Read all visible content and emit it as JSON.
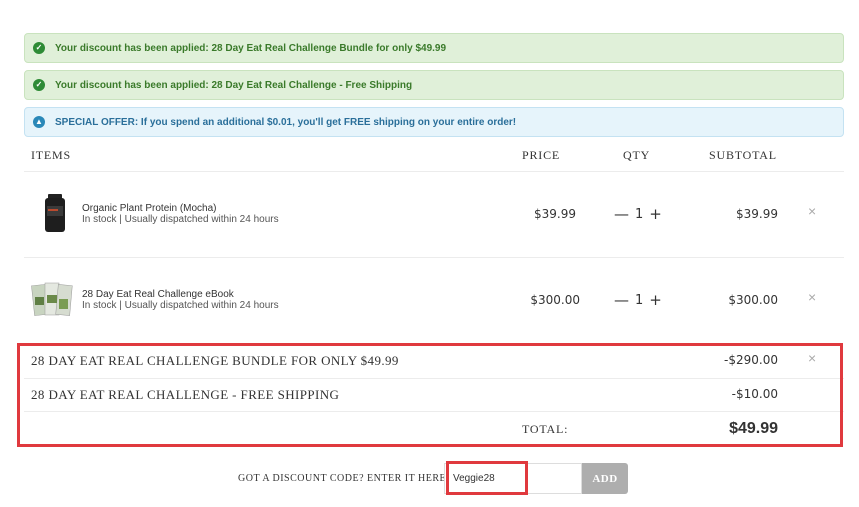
{
  "notices": [
    {
      "type": "success",
      "icon": "check-circle-icon",
      "text": "Your discount has been applied: 28 Day Eat Real Challenge Bundle for only $49.99"
    },
    {
      "type": "success",
      "icon": "check-circle-icon",
      "text": "Your discount has been applied: 28 Day Eat Real Challenge - Free Shipping"
    },
    {
      "type": "info",
      "icon": "info-drop-icon",
      "text": "SPECIAL OFFER: If you spend an additional $0.01, you'll get FREE shipping on your entire order!"
    }
  ],
  "table": {
    "headers": {
      "items": "ITEMS",
      "price": "PRICE",
      "qty": "QTY",
      "subtotal": "SUBTOTAL"
    }
  },
  "items": [
    {
      "name": "Organic Plant Protein (Mocha)",
      "stock": "In stock | Usually dispatched within 24 hours",
      "price": "$39.99",
      "qty": "1",
      "subtotal": "$39.99"
    },
    {
      "name": "28 Day Eat Real Challenge eBook",
      "stock": "In stock | Usually dispatched within 24 hours",
      "price": "$300.00",
      "qty": "1",
      "subtotal": "$300.00"
    }
  ],
  "qty_controls": {
    "minus": "—",
    "plus": "+"
  },
  "remove_glyph": "×",
  "discounts": [
    {
      "label": "28 DAY EAT REAL CHALLENGE BUNDLE FOR ONLY $49.99",
      "amount": "-$290.00"
    },
    {
      "label": "28 DAY EAT REAL CHALLENGE - FREE SHIPPING",
      "amount": "-$10.00"
    }
  ],
  "total": {
    "label": "TOTAL:",
    "value": "$49.99"
  },
  "discount_code": {
    "label": "GOT A DISCOUNT CODE? ENTER IT HERE:",
    "value": "Veggie28",
    "button": "ADD"
  },
  "colors": {
    "success_bg": "#e0f0d9",
    "success_text": "#3a7a2a",
    "info_bg": "#e6f4fb",
    "info_text": "#2a6f9a",
    "highlight": "#e0393e",
    "add_button": "#aeaeae"
  }
}
